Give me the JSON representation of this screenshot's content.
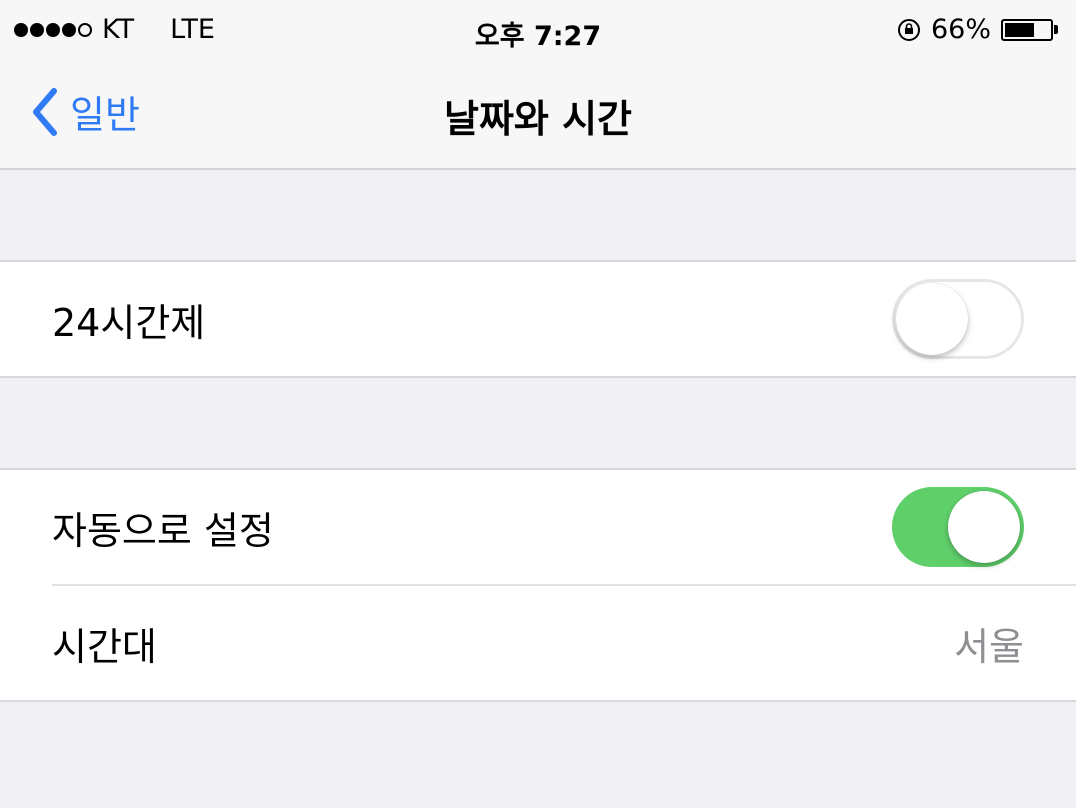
{
  "status_bar": {
    "signal_strength": 4,
    "signal_max": 5,
    "carrier": "KT",
    "network": "LTE",
    "time": "오후 7:27",
    "battery_percent": "66%",
    "battery_level": 0.66,
    "icons": [
      "orientation-lock-icon",
      "battery-icon"
    ]
  },
  "nav": {
    "back_label": "일반",
    "title": "날짜와 시간"
  },
  "groups": [
    {
      "rows": [
        {
          "label": "24시간제",
          "type": "toggle",
          "on": false
        }
      ]
    },
    {
      "rows": [
        {
          "label": "자동으로 설정",
          "type": "toggle",
          "on": true
        },
        {
          "label": "시간대",
          "type": "value",
          "value": "서울"
        }
      ]
    }
  ],
  "colors": {
    "accent": "#2f7bf5",
    "toggle_on": "#5fcf6a",
    "background": "#efeff4",
    "secondary_text": "#8e8e93"
  }
}
